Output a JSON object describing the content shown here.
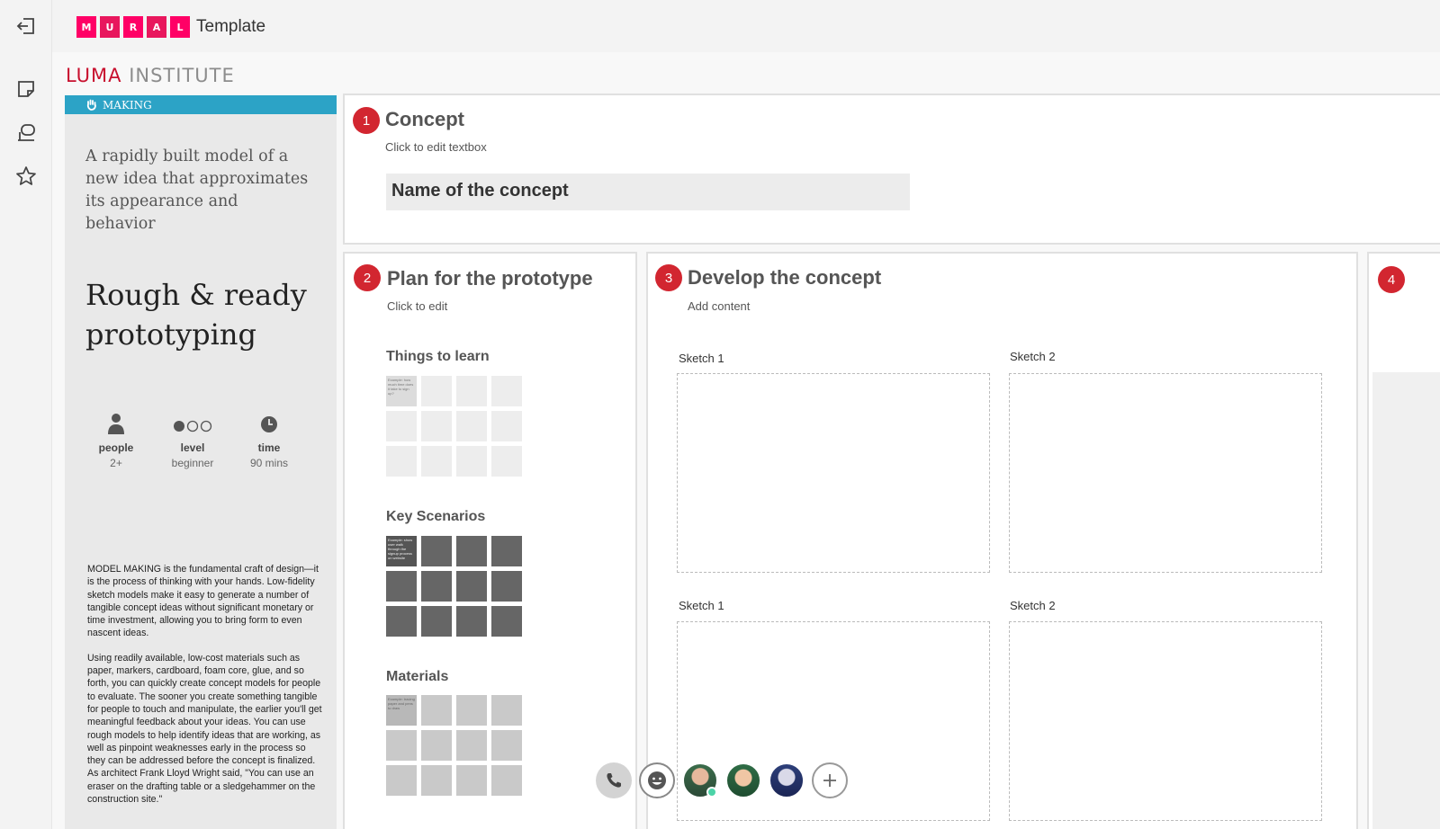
{
  "header": {
    "logo_letters": [
      "M",
      "U",
      "R",
      "A",
      "L"
    ],
    "title": "Template"
  },
  "rail": {
    "items": [
      {
        "icon": "exit-icon"
      },
      {
        "icon": "sticky-note-icon"
      },
      {
        "icon": "comment-icon"
      },
      {
        "icon": "star-icon"
      }
    ]
  },
  "brand": {
    "luma_a": "LUMA",
    "luma_b": " INSTITUTE"
  },
  "info": {
    "category": "MAKING",
    "tagline": "A rapidly built model of a new idea that approximates its appearance and behavior",
    "method_title": "Rough & ready prototyping",
    "stats": [
      {
        "label": "people",
        "value": "2+"
      },
      {
        "label": "level",
        "value": "beginner"
      },
      {
        "label": "time",
        "value": "90 mins"
      }
    ],
    "desc_1": "MODEL MAKING is the fundamental craft of design—it is the process of thinking with your hands. Low-fidelity sketch models make it easy to generate a number of tangible concept ideas without significant monetary or time investment, allowing you to bring form to even nascent ideas.",
    "desc_2": "Using readily available, low-cost materials such as paper, markers, cardboard, foam core, glue, and so forth, you can quickly create concept models for people to evaluate. The sooner you create something tangible for people to touch and manipulate, the earlier you'll get meaningful feedback about your ideas. You can use rough models to help identify ideas that are working, as well as pinpoint weaknesses early in the process so they can be addressed before the concept is finalized. As architect Frank Lloyd Wright said, \"You can use an eraser on the drafting table or a sledgehammer on the construction site.\""
  },
  "frames": {
    "concept": {
      "number": "1",
      "title": "Concept",
      "subtitle": "Click to edit textbox",
      "name_box": "Name of the concept"
    },
    "plan": {
      "number": "2",
      "title": "Plan for the prototype",
      "subtitle": "Click to edit",
      "sections": [
        "Things to learn",
        "Key Scenarios",
        "Materials"
      ],
      "note_1": "Example: how much time does it take to sign up?",
      "note_2": "Example: show user walk through the signup process on website",
      "note_3": "Example: tracing paper and pens to draw"
    },
    "develop": {
      "number": "3",
      "title": "Develop the concept",
      "subtitle": "Add content",
      "sketches": [
        "Sketch 1",
        "Sketch 2",
        "Sketch 1",
        "Sketch 2"
      ]
    },
    "next": {
      "number": "4"
    }
  },
  "callbar": {
    "items": [
      "phone-icon",
      "emoji-icon",
      "avatar",
      "avatar",
      "avatar",
      "plus-icon"
    ]
  },
  "colors": {
    "mural_pink": "#ff0066",
    "luma_red": "#c8102e",
    "making_blue": "#2ca3c6",
    "step_red": "#d22630"
  }
}
